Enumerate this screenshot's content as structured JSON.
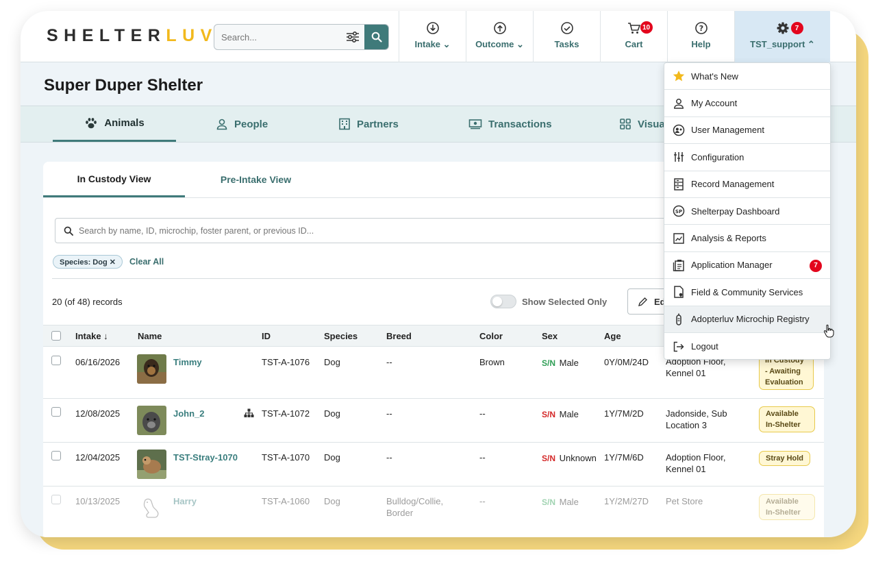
{
  "logo": {
    "part1": "SHELTER",
    "part2": "LUV"
  },
  "header_search": {
    "placeholder": "Search..."
  },
  "nav": [
    {
      "label": "Intake ⌄",
      "icon": "intake-icon"
    },
    {
      "label": "Outcome ⌄",
      "icon": "outcome-icon"
    },
    {
      "label": "Tasks",
      "icon": "tasks-check-icon"
    },
    {
      "label": "Cart",
      "icon": "cart-icon",
      "badge": "10"
    },
    {
      "label": "Help",
      "icon": "help-icon"
    },
    {
      "label": "TST_support ⌃",
      "icon": "gear-icon",
      "badge": "7"
    }
  ],
  "shelter_name": "Super Duper Shelter",
  "main_tabs": [
    "Animals",
    "People",
    "Partners",
    "Transactions",
    "Visual"
  ],
  "view_tabs": [
    "In Custody View",
    "Pre-Intake View"
  ],
  "animal_search": {
    "placeholder": "Search by name, ID, microchip, foster parent, or previous ID..."
  },
  "filters": {
    "chip": "Species: Dog ✕",
    "clear_all": "Clear All"
  },
  "records": "20 (of 48) records",
  "show_selected": "Show Selected Only",
  "edit_label": "Ed",
  "table": {
    "columns": [
      "Intake ↓",
      "Name",
      "ID",
      "Species",
      "Breed",
      "Color",
      "Sex",
      "Age"
    ],
    "rows": [
      {
        "intake": "06/16/2026",
        "name": "Timmy",
        "id": "TST-A-1076",
        "species": "Dog",
        "breed": "--",
        "color": "Brown",
        "sn": "S/N",
        "sex": "Male",
        "age": "0Y/0M/24D",
        "location": "Adoption Floor, Kennel 01",
        "status": "In Custody - Awaiting Evaluation"
      },
      {
        "intake": "12/08/2025",
        "name": "John_2",
        "id": "TST-A-1072",
        "species": "Dog",
        "breed": "--",
        "color": "--",
        "sn": "S/N",
        "sex": "Male",
        "age": "1Y/7M/2D",
        "location": "Jadonside, Sub Location 3",
        "status": "Available In-Shelter"
      },
      {
        "intake": "12/04/2025",
        "name": "TST-Stray-1070",
        "id": "TST-A-1070",
        "species": "Dog",
        "breed": "--",
        "color": "--",
        "sn": "S/N",
        "sex": "Unknown",
        "age": "1Y/7M/6D",
        "location": "Adoption Floor, Kennel 01",
        "status": "Stray Hold"
      },
      {
        "intake": "10/13/2025",
        "name": "Harry",
        "id": "TST-A-1060",
        "species": "Dog",
        "breed": "Bulldog/Collie, Border",
        "color": "--",
        "sn": "S/N",
        "sex": "Male",
        "age": "1Y/2M/27D",
        "location": "Pet Store",
        "status": "Available In-Shelter"
      }
    ]
  },
  "menu": [
    {
      "label": "What's New",
      "icon": "star-icon"
    },
    {
      "label": "My Account",
      "icon": "person-icon"
    },
    {
      "label": "User Management",
      "icon": "user-management-icon"
    },
    {
      "label": "Configuration",
      "icon": "sliders-icon"
    },
    {
      "label": "Record Management",
      "icon": "records-icon"
    },
    {
      "label": "Shelterpay Dashboard",
      "icon": "shelterpay-icon",
      "glyph": "SP"
    },
    {
      "label": "Analysis & Reports",
      "icon": "chart-icon"
    },
    {
      "label": "Application Manager",
      "icon": "clipboard-icon",
      "badge": "7"
    },
    {
      "label": "Field & Community Services",
      "icon": "field-services-icon"
    },
    {
      "label": "Adopterluv Microchip Registry",
      "icon": "microchip-icon"
    },
    {
      "label": "Logout",
      "icon": "logout-icon"
    }
  ],
  "colors": {
    "teal": "#3f7a7a",
    "gold": "#f2b91d",
    "badge": "#e3061d",
    "status_bg": "#fff7d4"
  }
}
